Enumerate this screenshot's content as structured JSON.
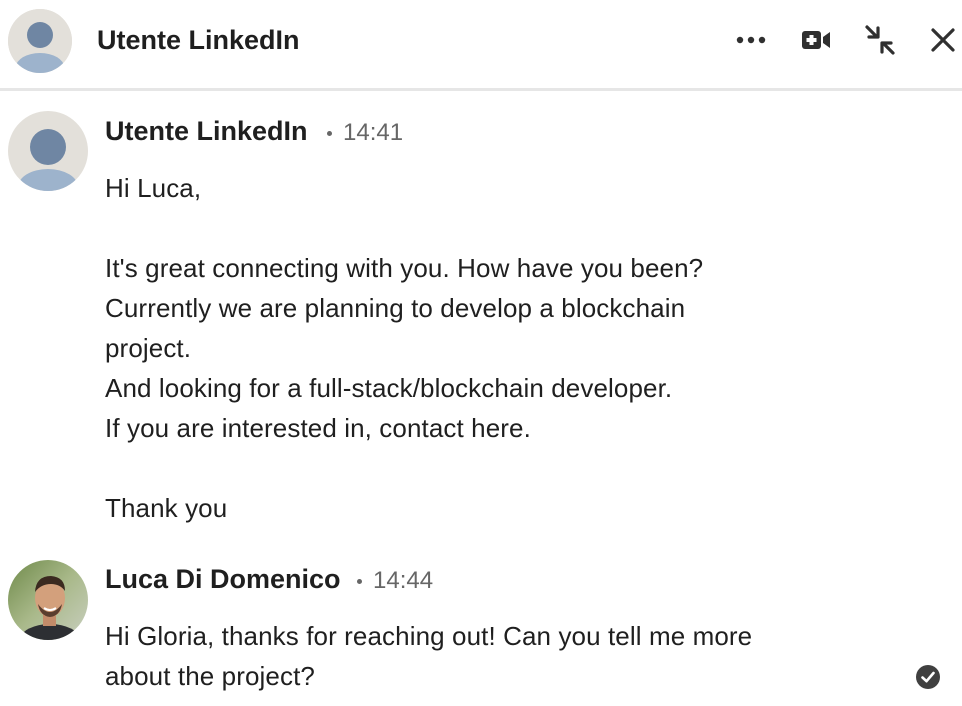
{
  "header": {
    "title": "Utente LinkedIn",
    "icons": [
      "more-icon",
      "video-call-icon",
      "minimize-icon",
      "close-icon"
    ]
  },
  "messages": [
    {
      "sender": "Utente LinkedIn",
      "time": "14:41",
      "lines": [
        "Hi Luca,",
        "",
        "It's great connecting with you. How have you been?",
        "Currently we are planning to develop a blockchain",
        "project.",
        "And looking for a full-stack/blockchain developer.",
        "If you are interested in, contact here.",
        "",
        "Thank you"
      ]
    },
    {
      "sender": "Luca Di Domenico",
      "time": "14:44",
      "lines": [
        "Hi Gloria, thanks for reaching out! Can you tell me more",
        "about the project?"
      ]
    }
  ],
  "colors": {
    "text": "#1f1f1f",
    "muted": "#666666",
    "divider": "#e6e6e6",
    "avatar_bg": "#e3e0da",
    "avatar_fg": "#8fa6bf",
    "icon": "#404040"
  }
}
